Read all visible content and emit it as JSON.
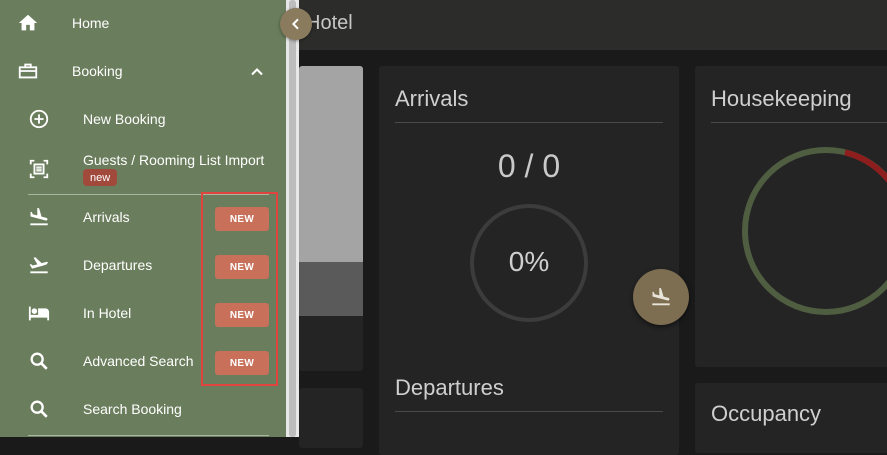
{
  "sidebar": {
    "items": [
      {
        "label": "Home",
        "icon": "home-icon"
      },
      {
        "label": "Booking",
        "icon": "briefcase-icon"
      },
      {
        "label": "New Booking",
        "icon": "add-circle-icon"
      },
      {
        "label": "Guests / Rooming List Import",
        "icon": "scan-document-icon",
        "pill": "new"
      },
      {
        "label": "Arrivals",
        "icon": "flight-land-icon",
        "badge": "NEW"
      },
      {
        "label": "Departures",
        "icon": "flight-takeoff-icon",
        "badge": "NEW"
      },
      {
        "label": "In Hotel",
        "icon": "bed-icon",
        "badge": "NEW"
      },
      {
        "label": "Advanced Search",
        "icon": "search-icon",
        "badge": "NEW"
      },
      {
        "label": "Search Booking",
        "icon": "search-icon"
      }
    ]
  },
  "topbar": {
    "title": "Hotel"
  },
  "cards": {
    "arrivals": {
      "title": "Arrivals",
      "count": "0 / 0",
      "percent": "0%"
    },
    "housekeeping": {
      "title": "Housekeeping"
    },
    "departures": {
      "title": "Departures"
    },
    "occupancy": {
      "title": "Occupancy"
    }
  },
  "colors": {
    "sidebar_bg": "#6a7d5c",
    "badge": "#c9705b",
    "pill": "#a14a3c",
    "ring_green": "#4f5d40",
    "ring_red": "#8e1e1e",
    "accent_button": "#8b7b5e"
  }
}
